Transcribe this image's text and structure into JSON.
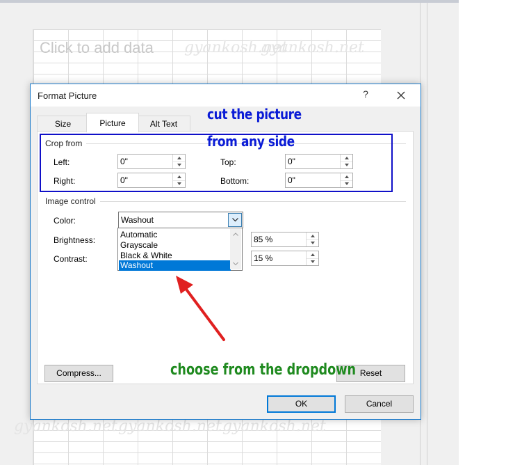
{
  "background": {
    "placeholder": "Click to add data",
    "watermark": "gyankosh.net"
  },
  "dialog": {
    "title": "Format Picture",
    "help_glyph": "?",
    "tabs": [
      "Size",
      "Picture",
      "Alt Text"
    ],
    "active_tab": "Picture",
    "crop_from": {
      "label": "Crop from",
      "left": {
        "label": "Left:",
        "value": "0\""
      },
      "right": {
        "label": "Right:",
        "value": "0\""
      },
      "top": {
        "label": "Top:",
        "value": "0\""
      },
      "bottom": {
        "label": "Bottom:",
        "value": "0\""
      }
    },
    "image_control": {
      "label": "Image control",
      "color_label": "Color:",
      "color_value": "Washout",
      "color_options": [
        "Automatic",
        "Grayscale",
        "Black & White",
        "Washout"
      ],
      "selected_option": "Washout",
      "brightness_label": "Brightness:",
      "brightness_value": "85 %",
      "contrast_label": "Contrast:",
      "contrast_value": "15 %"
    },
    "buttons": {
      "compress": "Compress...",
      "reset": "Reset",
      "ok": "OK",
      "cancel": "Cancel"
    }
  },
  "annotations": {
    "crop_note_line1": "cut the picture",
    "crop_note_line2": "from any side",
    "dropdown_note": "choose from the dropdown",
    "crop_color": "#0a1bd6",
    "dropdown_color": "#1f8a1f",
    "arrow_color": "#e02020"
  },
  "colors": {
    "accent": "#0078d7",
    "dialog_border": "#1979ca"
  }
}
